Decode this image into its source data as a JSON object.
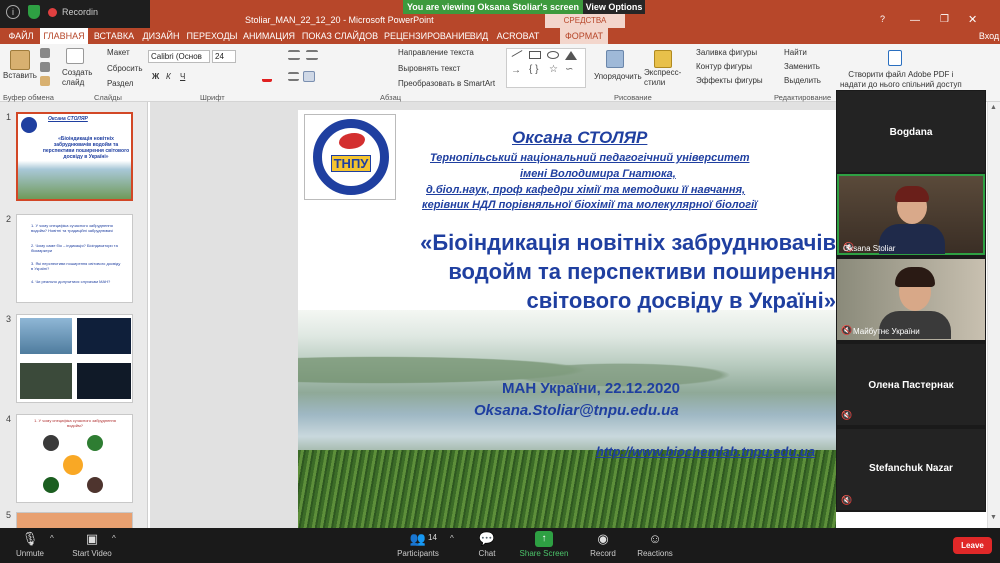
{
  "zoom_bar": {
    "recording_label": "Recording"
  },
  "banner": {
    "viewing": "You are viewing Oksana Stoliar's screen",
    "view_options": "View Options"
  },
  "window": {
    "title": "Stoliar_MAN_22_12_20 - Microsoft PowerPoint",
    "context_tab": "СРЕДСТВА РИСОВАНИЯ"
  },
  "tabs": [
    {
      "label": "ФАЙЛ"
    },
    {
      "label": "ГЛАВНАЯ"
    },
    {
      "label": "ВСТАВКА"
    },
    {
      "label": "ДИЗАЙН"
    },
    {
      "label": "ПЕРЕХОДЫ"
    },
    {
      "label": "АНИМАЦИЯ"
    },
    {
      "label": "ПОКАЗ СЛАЙДОВ"
    },
    {
      "label": "РЕЦЕНЗИРОВАНИЕ"
    },
    {
      "label": "ВИД"
    },
    {
      "label": "ACROBAT"
    },
    {
      "label": "ФОРМАТ"
    }
  ],
  "signin": "Вход",
  "ribbon": {
    "paste": "Вставить",
    "clipboard": "Буфер обмена",
    "create_slide": "Создать\nслайд",
    "layout": "Макет",
    "reset": "Сбросить",
    "section": "Раздел",
    "slides": "Слайды",
    "font_name": "Calibri (Основ",
    "font_size": "24",
    "font": "Шрифт",
    "text_direction": "Направление текста",
    "align_text": "Выровнять текст",
    "smartart": "Преобразовать в SmartArt",
    "paragraph": "Абзац",
    "arrange": "Упорядочить",
    "quick_styles": "Экспресс-\nстили",
    "shape_fill": "Заливка фигуры",
    "shape_outline": "Контур фигуры",
    "shape_effects": "Эффекты фигуры",
    "drawing": "Рисование",
    "find": "Найти",
    "replace": "Заменить",
    "select": "Выделить",
    "editing": "Редактирование",
    "adobe": "Створити файл Adobe PDF і\nнадати до нього спільний доступ"
  },
  "thumbs": [
    {
      "num": "1"
    },
    {
      "num": "2"
    },
    {
      "num": "3"
    },
    {
      "num": "4"
    },
    {
      "num": "5"
    }
  ],
  "thumb1": {
    "name": "Оксана СТОЛЯР",
    "title": "«Біоіндикація новітніх забруднювачів водойм та перспективи поширення світового досвіду в Україні»"
  },
  "thumb2": {
    "items": [
      "1. У чому специфіка сучасного забруднення водойм? Новітні та традиційні забруднювачі",
      "2. Чому саме біо – індикація? Біоіндикатори та біомаркери",
      "3. Які перспективи поширення світового досвіду в Україні?",
      "4. Чи реально долучитися слухачам МАН?"
    ]
  },
  "thumb4": {
    "title": "1. У чому специфіка сучасного забруднення водойм?"
  },
  "slide": {
    "logo_text": "ТНПУ",
    "author": "Оксана СТОЛЯР",
    "uni1": "Тернопільський національний педагогічний університет",
    "uni2": "імені Володимира Гнатюка,",
    "degree": "д.біол.наук, проф кафедри хімії та методики її навчання,",
    "head": "керівник НДЛ порівняльної біохімії та молекулярної біології",
    "title": "«Біоіндикація новітніх забруднювачів водойм та перспективи поширення світового досвіду в Україні»",
    "event": "МАН України, 22.12.2020",
    "email": "Oksana.Stoliar@tnpu.edu.ua",
    "url": "http://www.biochemlab.tnpu.edu.ua"
  },
  "participants_panel": [
    {
      "name": "Bogdana",
      "video": false
    },
    {
      "name": "Oksana Stoliar",
      "video": true
    },
    {
      "name": "Майбутнє України",
      "video": true
    },
    {
      "name": "Олена Пастернак",
      "video": false
    },
    {
      "name": "Stefanchuk Nazar",
      "video": false
    }
  ],
  "toolbar": {
    "unmute": "Unmute",
    "start_video": "Start Video",
    "participants": "Participants",
    "participant_count": "14",
    "chat": "Chat",
    "share_screen": "Share Screen",
    "record": "Record",
    "reactions": "Reactions",
    "leave": "Leave"
  },
  "colors": {
    "ppt_accent": "#b7472a",
    "share_green": "#3d9a3d",
    "leave_red": "#e02828",
    "slide_blue": "#1f3fa0"
  }
}
